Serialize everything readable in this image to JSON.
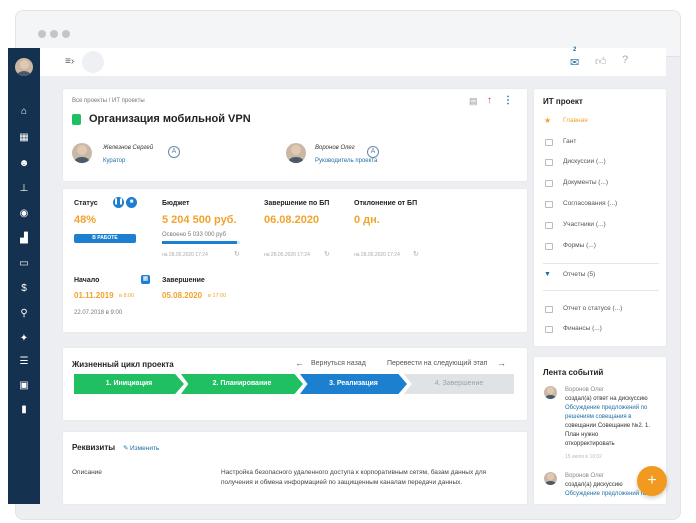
{
  "colors": {
    "sidebar": "#14324f",
    "accent": "#f2a32d",
    "link": "#1d6fa5",
    "stage_done": "#1fbf62",
    "stage_active": "#1c7fd0",
    "stage_future": "#e0e3e6"
  },
  "topbar": {
    "mail_count": "2"
  },
  "breadcrumb": "Все проекты / ИТ проекты",
  "project": {
    "title": "Организация мобильной VPN"
  },
  "people": [
    {
      "name": "Железнов Сергей",
      "role": "Куратор"
    },
    {
      "name": "Воронов Олег",
      "role": "Руководитель проекта"
    }
  ],
  "metrics": {
    "status_label": "Статус",
    "status_value": "48%",
    "status_badge": "В РАБОТЕ",
    "budget_label": "Бюджет",
    "budget_value": "5 204 500 руб.",
    "budget_sub": "Освоено  5 033 000 руб",
    "budget_progress": 0.967,
    "end_bp_label": "Завершение по БП",
    "end_bp_value": "06.08.2020",
    "deviation_label": "Отклонение от БП",
    "deviation_value": "0 дн.",
    "stamp1": "на 28.05.2020 17:24",
    "stamp2": "на 28.05.2020 17:24",
    "stamp3": "на 28.05.2020 17:24",
    "start_label": "Начало",
    "start_value": "01.11.2019",
    "start_time": "в 8:00",
    "start_plan": "22.07.2018 в 9:00",
    "finish_label": "Завершение",
    "finish_value": "05.08.2020",
    "finish_time": "в 17:00"
  },
  "lifecycle": {
    "title": "Жизненный цикл проекта",
    "back": "Вернуться назад",
    "next": "Перевести на следующий этап",
    "stages": [
      "1. Инициация",
      "2. Планирование",
      "3. Реализация",
      "4. Завершение"
    ]
  },
  "requisites": {
    "title": "Реквизиты",
    "edit": "Изменить",
    "desc_label": "Описание",
    "desc_line1": "Настройка безопасного удаленного доступа к корпоративным сетям, базам данных для",
    "desc_line2": "получения и обмена информацией по защищенным каналам передачи данных."
  },
  "right_menu": {
    "title": "ИТ проект",
    "items": [
      "Главная",
      "Гант",
      "Дискуссии (...)",
      "Документы (...)",
      "Согласования (...)",
      "Участники (...)",
      "Формы (...)",
      "Отчеты (5)",
      "Отчет о статусе (...)",
      "Финансы (...)"
    ]
  },
  "feed": {
    "title": "Лента событий",
    "e1": {
      "author": "Воронов Олег",
      "l1": "создал(а) ответ на дискуссию",
      "l2": "Обсуждение предложений по",
      "l3": "решениям совещания в",
      "l4": "совещании Совещание №2. 1.",
      "l5": "План нужно",
      "l6": "откорректировать",
      "time": "15 июля в 10:02"
    },
    "e2": {
      "author": "Воронов Олег",
      "l1": "создал(а) дискуссию",
      "l2": "Обсуждение предложений по"
    }
  }
}
